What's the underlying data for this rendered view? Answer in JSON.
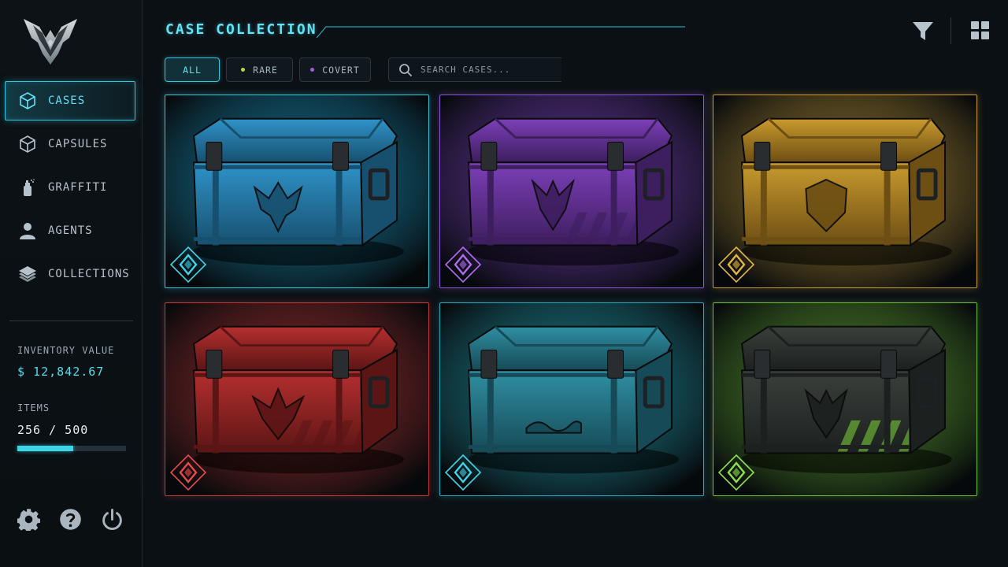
{
  "sidebar": {
    "logo_icon": "winged-emblem-logo",
    "nav": [
      {
        "label": "CASES",
        "icon": "cube-icon",
        "active": true
      },
      {
        "label": "CAPSULES",
        "icon": "cube-outline-icon",
        "active": false
      },
      {
        "label": "GRAFFITI",
        "icon": "spray-can-icon",
        "active": false
      },
      {
        "label": "AGENTS",
        "icon": "person-icon",
        "active": false
      },
      {
        "label": "COLLECTIONS",
        "icon": "layers-icon",
        "active": false
      }
    ],
    "inventory_label": "INVENTORY VALUE",
    "inventory_value": "$ 12,842.67",
    "items_label": "ITEMS",
    "items_value": "256 / 500",
    "items_fraction": 0.512,
    "bottom_icons": [
      "settings-gear-icon",
      "help-icon",
      "power-icon"
    ]
  },
  "header": {
    "title": "CASE COLLECTION",
    "icons": [
      "filter-funnel-icon",
      "grid-view-icon"
    ]
  },
  "filters": {
    "chips": [
      {
        "label": "ALL",
        "active": true,
        "dot_color": ""
      },
      {
        "label": "RARE",
        "active": false,
        "dot_color": "#b6d84a"
      },
      {
        "label": "COVERT",
        "active": false,
        "dot_color": "#a35ce0"
      }
    ],
    "search_placeholder": "SEARCH CASES..."
  },
  "cases": [
    {
      "color": "#2f93c9",
      "dark": "#17506f",
      "glow": "#1fb6e8",
      "border": "#2ec7de",
      "emblem": "winged-crest",
      "badge_color": "#3ed4e8"
    },
    {
      "color": "#7c3fb8",
      "dark": "#3d1e5e",
      "glow": "#9b4ff0",
      "border": "#8f55d8",
      "emblem": "horned-crest",
      "badge_color": "#b06cf0"
    },
    {
      "color": "#c99a2e",
      "dark": "#6d4f14",
      "glow": "#e8b640",
      "border": "#c99a2e",
      "emblem": "shield-crest",
      "badge_color": "#e1b444"
    },
    {
      "color": "#b62f2f",
      "dark": "#5c1515",
      "glow": "#e03a3a",
      "border": "#c23a3a",
      "emblem": "phoenix-crest",
      "badge_color": "#e44b4b"
    },
    {
      "color": "#2f8fa3",
      "dark": "#164a56",
      "glow": "#2bc7dc",
      "border": "#2aa8bb",
      "emblem": "palm-wave-crest",
      "badge_color": "#3ed4e8"
    },
    {
      "color": "#3a3f3c",
      "dark": "#1c201e",
      "glow": "#7ed63a",
      "border": "#6fbd34",
      "emblem": "striped-crest",
      "badge_color": "#8ee04a"
    }
  ]
}
